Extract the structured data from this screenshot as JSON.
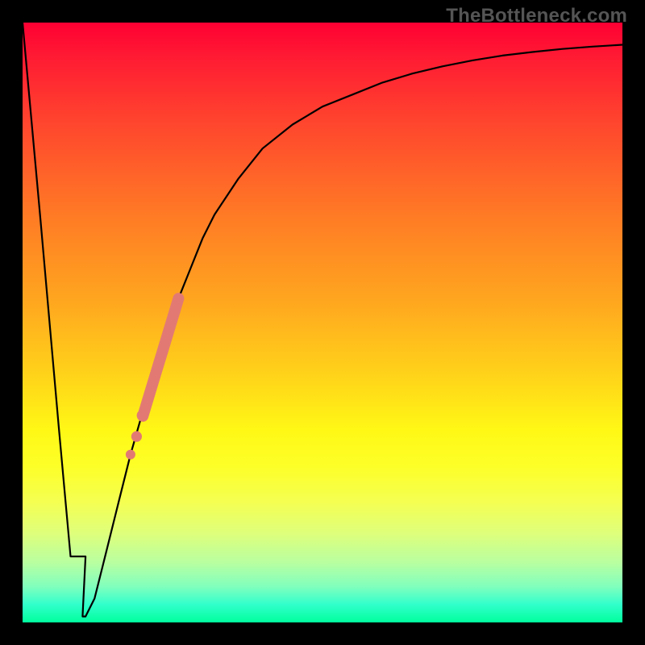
{
  "brand": "TheBottleneck.com",
  "chart_data": {
    "type": "line",
    "title": "",
    "xlabel": "",
    "ylabel": "",
    "xlim": [
      0,
      100
    ],
    "ylim": [
      0,
      100
    ],
    "grid": false,
    "curve": {
      "x": [
        0,
        3,
        6,
        8,
        10,
        10.5,
        12,
        14,
        16,
        18,
        20,
        22,
        24,
        26,
        28,
        30,
        32,
        36,
        40,
        45,
        50,
        55,
        60,
        65,
        70,
        75,
        80,
        85,
        90,
        95,
        100
      ],
      "y": [
        100,
        67,
        33,
        11,
        1,
        1,
        4,
        12,
        20,
        28,
        35,
        42,
        48,
        54,
        59,
        64,
        68,
        74,
        79,
        83,
        86,
        88,
        90,
        91.5,
        92.7,
        93.7,
        94.5,
        95.1,
        95.6,
        96.0,
        96.3
      ],
      "flat_bottom_x": [
        8,
        10.5
      ]
    },
    "highlight_segment": {
      "color": "#e27a73",
      "x": [
        17.5,
        26.0
      ],
      "y": [
        26.0,
        54.0
      ],
      "thick_from_idx": 3
    },
    "highlight_dots": {
      "color": "#e27a73",
      "points": [
        {
          "x": 18.0,
          "y": 28.0
        },
        {
          "x": 19.0,
          "y": 31.0
        },
        {
          "x": 20.0,
          "y": 34.5
        }
      ]
    }
  }
}
